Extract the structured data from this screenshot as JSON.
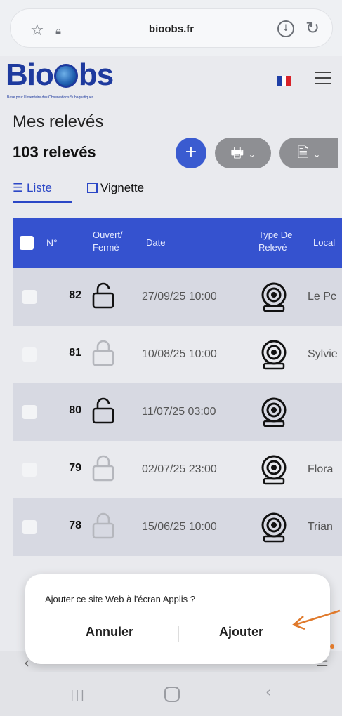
{
  "browser": {
    "url": "bioobs.fr"
  },
  "site": {
    "logo_text_left": "Bio",
    "logo_text_right": "bs",
    "logo_subtitle": "Base pour l'Inventaire des Observations Subaquatiques"
  },
  "page": {
    "title": "Mes relevés",
    "count": "103 relevés",
    "add_label": "+",
    "tabs": [
      {
        "label": "Liste"
      },
      {
        "label": "Vignette"
      }
    ]
  },
  "table": {
    "headers": {
      "num": "N°",
      "open": "Ouvert/ Fermé",
      "date": "Date",
      "type": "Type De Relevé",
      "local": "Local"
    },
    "rows": [
      {
        "num": "82",
        "status": "open",
        "date": "27/09/25 10:00",
        "local": "Le Pc"
      },
      {
        "num": "81",
        "status": "closed",
        "date": "10/08/25 10:00",
        "local": "Sylvie"
      },
      {
        "num": "80",
        "status": "open",
        "date": "11/07/25 03:00",
        "local": ""
      },
      {
        "num": "79",
        "status": "closed",
        "date": "02/07/25 23:00",
        "local": "Flora"
      },
      {
        "num": "78",
        "status": "closed",
        "date": "15/06/25 10:00",
        "local": "Trian"
      }
    ]
  },
  "popup": {
    "message": "Ajouter ce site Web à l'écran Applis ?",
    "cancel": "Annuler",
    "add": "Ajouter"
  },
  "colors": {
    "accent": "#3552cf",
    "arrow": "#e07a2c"
  }
}
